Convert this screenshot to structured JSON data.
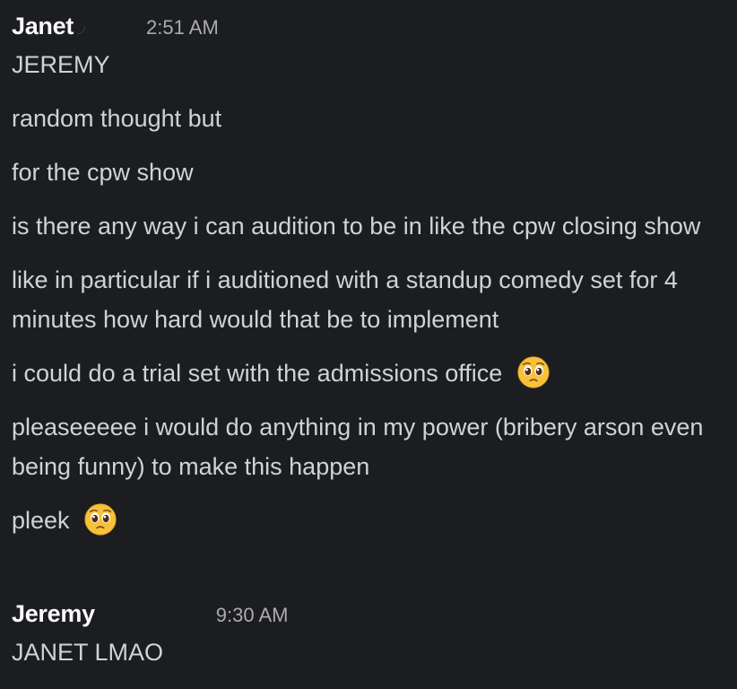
{
  "messages": [
    {
      "author": "Janet",
      "timestamp": "2:51 AM",
      "lines": [
        "JEREMY",
        "random thought but",
        "for the cpw show",
        "is there any way i can audition to be in like the cpw closing show",
        "like in particular if i auditioned with a standup comedy set for 4 minutes how hard would that be to implement",
        "i could do a trial set with the admissions office",
        "pleaseeeee i would do anything in my power (bribery arson even being funny) to make this happen",
        "pleek"
      ],
      "emoji": "pleading-face-emoji"
    },
    {
      "author": "Jeremy",
      "timestamp": "9:30 AM",
      "lines": [
        "JANET LMAO"
      ]
    }
  ],
  "colors": {
    "background": "#1b1d21",
    "text": "#d1d2d3",
    "author": "#f8f8f8",
    "timestamp": "#ababad"
  }
}
